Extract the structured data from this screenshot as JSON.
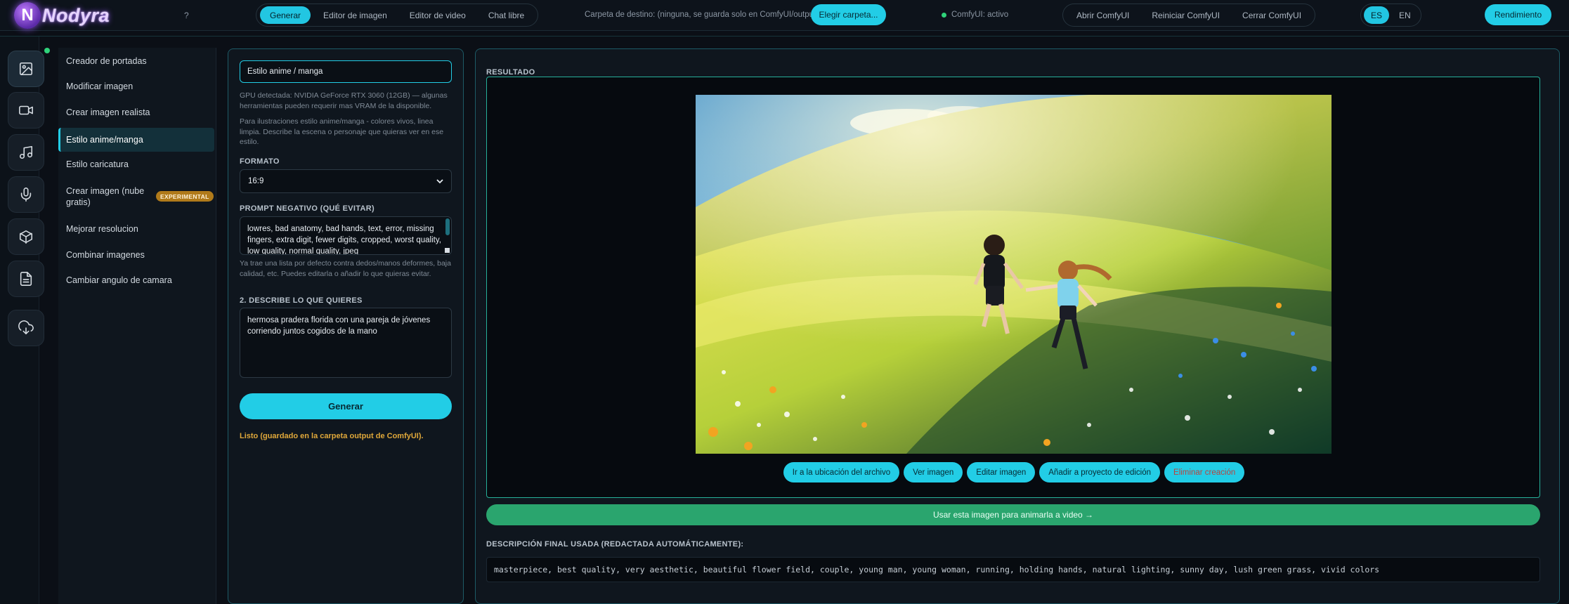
{
  "brand": {
    "logo_letter": "N",
    "name": "Nodyra"
  },
  "header": {
    "help": "?",
    "mode_tabs": [
      "Generar",
      "Editor de imagen",
      "Editor de video",
      "Chat libre"
    ],
    "destination_text": "Carpeta de destino: (ninguna, se guarda solo en ComfyUI/output)",
    "choose_folder": "Elegir carpeta...",
    "status": "ComfyUI: activo",
    "comfy_buttons": [
      "Abrir ComfyUI",
      "Reiniciar ComfyUI",
      "Cerrar ComfyUI"
    ],
    "languages": [
      "ES",
      "EN"
    ],
    "performance": "Rendimiento"
  },
  "rail_icons": [
    "image-icon",
    "video-icon",
    "music-icon",
    "microphone-icon",
    "cube-icon",
    "document-icon",
    "cloud-download-icon"
  ],
  "submenu": {
    "items": [
      "Creador de portadas",
      "Modificar imagen",
      "Crear imagen realista",
      "Estilo anime/manga",
      "Estilo caricatura",
      "Crear imagen (nube gratis)",
      "Mejorar resolucion",
      "Combinar imagenes",
      "Cambiar angulo de camara"
    ],
    "experimental_badge": "EXPERIMENTAL"
  },
  "form": {
    "title_value": "Estilo anime / manga",
    "gpu_note": "GPU detectada: NVIDIA GeForce RTX 3060 (12GB) — algunas herramientas pueden requerir mas VRAM de la disponible.",
    "style_note": "Para ilustraciones estilo anime/manga - colores vivos, linea limpia. Describe la escena o personaje que quieras ver en ese estilo.",
    "format_label": "FORMATO",
    "format_value": "16:9",
    "negative_label": "PROMPT NEGATIVO (QUÉ EVITAR)",
    "negative_value": "lowres, bad anatomy, bad hands, text, error, missing fingers, extra digit, fewer digits, cropped, worst quality, low quality, normal quality, jpeg",
    "negative_note": "Ya trae una lista por defecto contra dedos/manos deformes, baja calidad, etc. Puedes editarla o añadir lo que quieras evitar.",
    "describe_label": "2. DESCRIBE LO QUE QUIERES",
    "describe_value": "hermosa pradera florida con una pareja de jóvenes corriendo juntos cogidos de la mano",
    "generate_button": "Generar",
    "status_message": "Listo (guardado en la carpeta output de ComfyUI)."
  },
  "result": {
    "title": "RESULTADO",
    "actions": [
      "Ir a la ubicación del archivo",
      "Ver imagen",
      "Editar imagen",
      "Añadir a proyecto de edición",
      "Eliminar creación"
    ],
    "animate_button": "Usar esta imagen para animarla a video →",
    "final_label": "DESCRIPCIÓN FINAL USADA (REDACTADA AUTOMÁTICAMENTE):",
    "final_prompt": "masterpiece, best quality, very aesthetic, beautiful flower field, couple, young man, young woman, running, holding hands, natural lighting, sunny day, lush green grass, vivid colors"
  },
  "colors": {
    "accent": "#22cde6",
    "background": "#0b0f16",
    "panel": "#0f161e",
    "panel_border": "#1d5a66",
    "success": "#2aa56e",
    "warning_text": "#e0a83a",
    "badge": "#b07a1a"
  }
}
